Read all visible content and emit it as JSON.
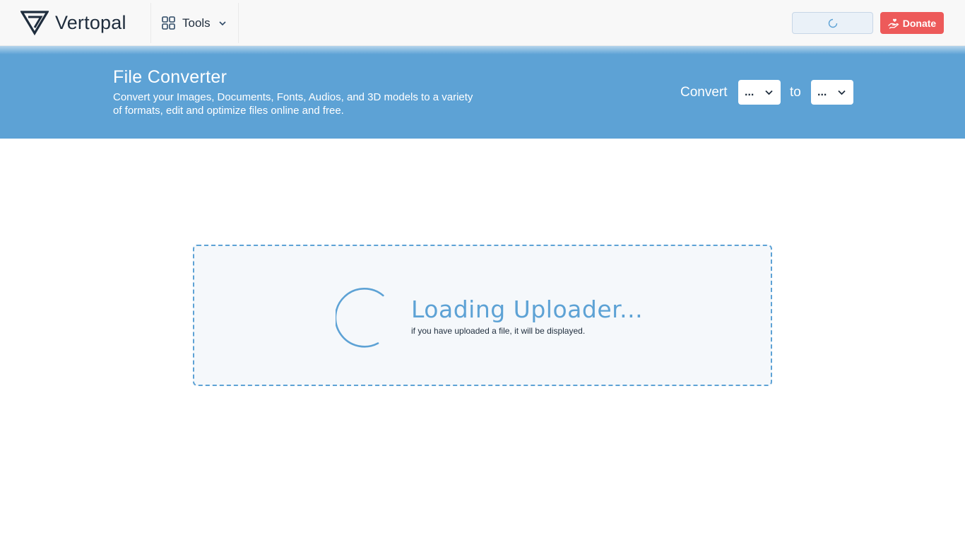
{
  "navbar": {
    "brand_name": "Vertopal",
    "tools_label": "Tools",
    "donate_label": "Donate"
  },
  "hero": {
    "title": "File Converter",
    "description": "Convert your Images, Documents, Fonts, Audios, and 3D models to a variety of formats, edit and optimize files online and free.",
    "convert_label": "Convert",
    "to_label": "to",
    "from_format": "...",
    "to_format": "..."
  },
  "uploader": {
    "title": "Loading Uploader...",
    "note": "if you have uploaded a file, it will be displayed."
  },
  "colors": {
    "accent": "#5da2d5",
    "donate": "#ed5a5a",
    "navbar_bg": "#f8f8f8",
    "text_dark": "#1f2d3d"
  },
  "icons": {
    "logo": "vertopal-logo-icon",
    "tools": "grid-icon",
    "tools_chevron": "chevron-down-icon",
    "login_spinner": "spinner-icon",
    "donate": "hand-heart-icon",
    "select_chevron": "chevron-down-icon",
    "uploader_spinner": "spinner-icon"
  }
}
